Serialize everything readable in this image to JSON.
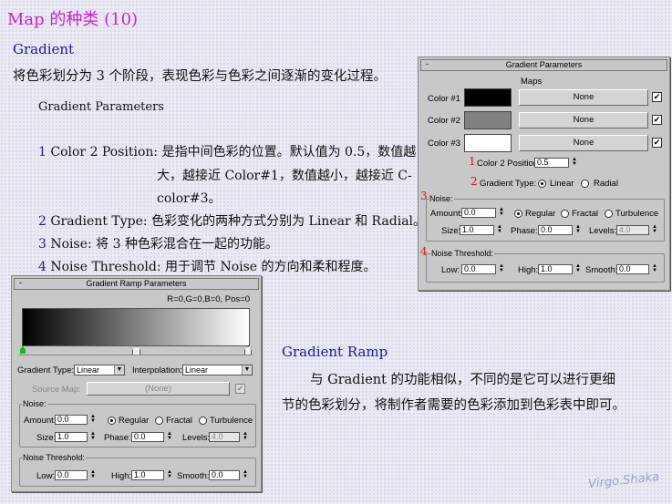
{
  "title": "Map 的种类 (10)",
  "gradient": {
    "heading": "Gradient",
    "intro": "将色彩划分为 3 个阶段，表现色彩与色彩之间逐渐的变化过程。",
    "params_heading": "Gradient Parameters",
    "items": [
      {
        "num": "1",
        "line1": "Color 2 Position: 是指中间色彩的位置。默认值为 0.5，数值越",
        "line2": "大，越接近 Color#1，数值越小，越接近 C-",
        "line3": "color#3。"
      },
      {
        "num": "2",
        "line1": "Gradient Type: 色彩变化的两种方式分别为 Linear 和 Radial。"
      },
      {
        "num": "3",
        "line1": "Noise: 将 3 种色彩混合在一起的功能。"
      },
      {
        "num": "4",
        "line1": "Noise Threshold: 用于调节 Noise 的方向和柔和程度。"
      }
    ]
  },
  "gradient_ramp": {
    "heading": "Gradient Ramp",
    "line1": "与 Gradient 的功能相似，不同的是它可以进行更细",
    "line2": "节的色彩划分，将制作者需要的色彩添加到色彩表中即可。"
  },
  "gp_panel": {
    "title": "Gradient Parameters",
    "minus": "-",
    "maps_label": "Maps",
    "colors": [
      {
        "label": "Color #1",
        "swatch": "#000000",
        "map": "None",
        "check": "✔"
      },
      {
        "label": "Color #2",
        "swatch": "#808080",
        "map": "None",
        "check": "✔"
      },
      {
        "label": "Color #3",
        "swatch": "#ffffff",
        "map": "None",
        "check": "✔"
      }
    ],
    "marker1": "1",
    "color2_pos_label": "Color 2 Position:",
    "color2_pos_value": "0.5",
    "marker2": "2",
    "gradient_type_label": "Gradient Type:",
    "linear": "Linear",
    "radial": "Radial",
    "marker3": "3",
    "noise_group": "Noise:",
    "amount_label": "Amount:",
    "amount": "0.0",
    "regular": "Regular",
    "fractal": "Fractal",
    "turbulence": "Turbulence",
    "size_label": "Size:",
    "size": "1.0",
    "phase_label": "Phase:",
    "phase": "0.0",
    "levels_label": "Levels:",
    "levels": "4.0",
    "marker4": "4",
    "threshold_group": "Noise Threshold:",
    "low_label": "Low:",
    "low": "0.0",
    "high_label": "High:",
    "high": "1.0",
    "smooth_label": "Smooth:",
    "smooth": "0.0"
  },
  "gr_panel": {
    "title": "Gradient Ramp Parameters",
    "minus": "-",
    "rgb_readout": "R=0,G=0,B=0, Pos=0",
    "gradient_type_label": "Gradient Type:",
    "gradient_type": "Linear",
    "interpolation_label": "Interpolation:",
    "interpolation": "Linear",
    "source_map_label": "Source Map:",
    "source_map": "(None)",
    "source_check": "✔",
    "noise_group": "Noise:",
    "amount_label": "Amount:",
    "amount": "0.0",
    "regular": "Regular",
    "fractal": "Fractal",
    "turbulence": "Turbulence",
    "size_label": "Size:",
    "size": "1.0",
    "phase_label": "Phase:",
    "phase": "0.0",
    "levels_label": "Levels:",
    "levels": "4.0",
    "threshold_group": "Noise Threshold:",
    "low_label": "Low:",
    "low": "0.0",
    "high_label": "High:",
    "high": "1.0",
    "smooth_label": "Smooth:",
    "smooth": "0.0",
    "flag_color_active": "#10c010"
  },
  "signature": "Virgo.Shaka"
}
